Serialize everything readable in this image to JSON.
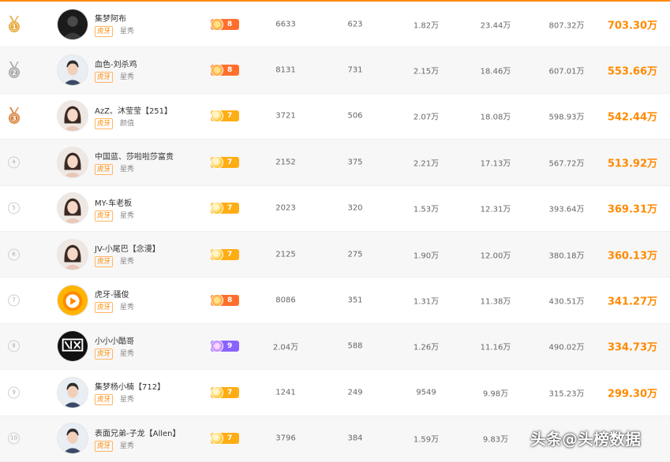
{
  "colors": {
    "accent": "#ff8a00",
    "gold": "#e7a83a",
    "silver": "#a9a9a9",
    "bronze": "#d6843f"
  },
  "rows": [
    {
      "rank": "1",
      "medal": "gold",
      "name": "集梦阿布",
      "tag": "虎牙",
      "category": "星秀",
      "level": "8",
      "level_style": "orange",
      "v1": "6633",
      "v2": "623",
      "v3": "1.82万",
      "v4": "23.44万",
      "v5": "807.32万",
      "total": "703.30万",
      "avatar_icon": "avatar-portrait-dark"
    },
    {
      "rank": "2",
      "medal": "silver",
      "name": "血色-刘杀鸡",
      "tag": "虎牙",
      "category": "星秀",
      "level": "8",
      "level_style": "orange",
      "v1": "8131",
      "v2": "731",
      "v3": "2.15万",
      "v4": "18.46万",
      "v5": "607.01万",
      "total": "553.66万",
      "avatar_icon": "avatar-portrait-male"
    },
    {
      "rank": "3",
      "medal": "bronze",
      "name": "AzZ、沐莹莹【251】",
      "tag": "虎牙",
      "category": "颜值",
      "level": "7",
      "level_style": "yellow",
      "v1": "3721",
      "v2": "506",
      "v3": "2.07万",
      "v4": "18.08万",
      "v5": "598.93万",
      "total": "542.44万",
      "avatar_icon": "avatar-portrait-female"
    },
    {
      "rank": "4",
      "medal": "",
      "name": "中国蓝、莎啦啦莎富贵",
      "tag": "虎牙",
      "category": "星秀",
      "level": "7",
      "level_style": "yellow",
      "v1": "2152",
      "v2": "375",
      "v3": "2.21万",
      "v4": "17.13万",
      "v5": "567.72万",
      "total": "513.92万",
      "avatar_icon": "avatar-portrait-female"
    },
    {
      "rank": "5",
      "medal": "",
      "name": "MY-车老板",
      "tag": "虎牙",
      "category": "星秀",
      "level": "7",
      "level_style": "yellow",
      "v1": "2023",
      "v2": "320",
      "v3": "1.53万",
      "v4": "12.31万",
      "v5": "393.64万",
      "total": "369.31万",
      "avatar_icon": "avatar-portrait-female"
    },
    {
      "rank": "6",
      "medal": "",
      "name": "JV-小尾巴【念漫】",
      "tag": "虎牙",
      "category": "星秀",
      "level": "7",
      "level_style": "yellow",
      "v1": "2125",
      "v2": "275",
      "v3": "1.90万",
      "v4": "12.00万",
      "v5": "380.18万",
      "total": "360.13万",
      "avatar_icon": "avatar-portrait-female"
    },
    {
      "rank": "7",
      "medal": "",
      "name": "虎牙-骚俊",
      "tag": "虎牙",
      "category": "星秀",
      "level": "8",
      "level_style": "orange",
      "v1": "8086",
      "v2": "351",
      "v3": "1.31万",
      "v4": "11.38万",
      "v5": "430.51万",
      "total": "341.27万",
      "avatar_icon": "avatar-huya-logo"
    },
    {
      "rank": "8",
      "medal": "",
      "name": "小小小酷哥",
      "tag": "虎牙",
      "category": "星秀",
      "level": "9",
      "level_style": "purple",
      "v1": "2.04万",
      "v2": "588",
      "v3": "1.26万",
      "v4": "11.16万",
      "v5": "490.02万",
      "total": "334.73万",
      "avatar_icon": "avatar-calligraphy-logo"
    },
    {
      "rank": "9",
      "medal": "",
      "name": "集梦杨小楠【712】",
      "tag": "虎牙",
      "category": "星秀",
      "level": "7",
      "level_style": "yellow",
      "v1": "1241",
      "v2": "249",
      "v3": "9549",
      "v4": "9.98万",
      "v5": "315.23万",
      "total": "299.30万",
      "avatar_icon": "avatar-portrait-male"
    },
    {
      "rank": "10",
      "medal": "",
      "name": "表面兄弟-子龙【Allen】",
      "tag": "虎牙",
      "category": "星秀",
      "level": "7",
      "level_style": "yellow",
      "v1": "3796",
      "v2": "384",
      "v3": "1.59万",
      "v4": "9.83万",
      "v5": "",
      "total": "",
      "avatar_icon": "avatar-portrait-male"
    }
  ],
  "watermark": "头条@头榜数据"
}
